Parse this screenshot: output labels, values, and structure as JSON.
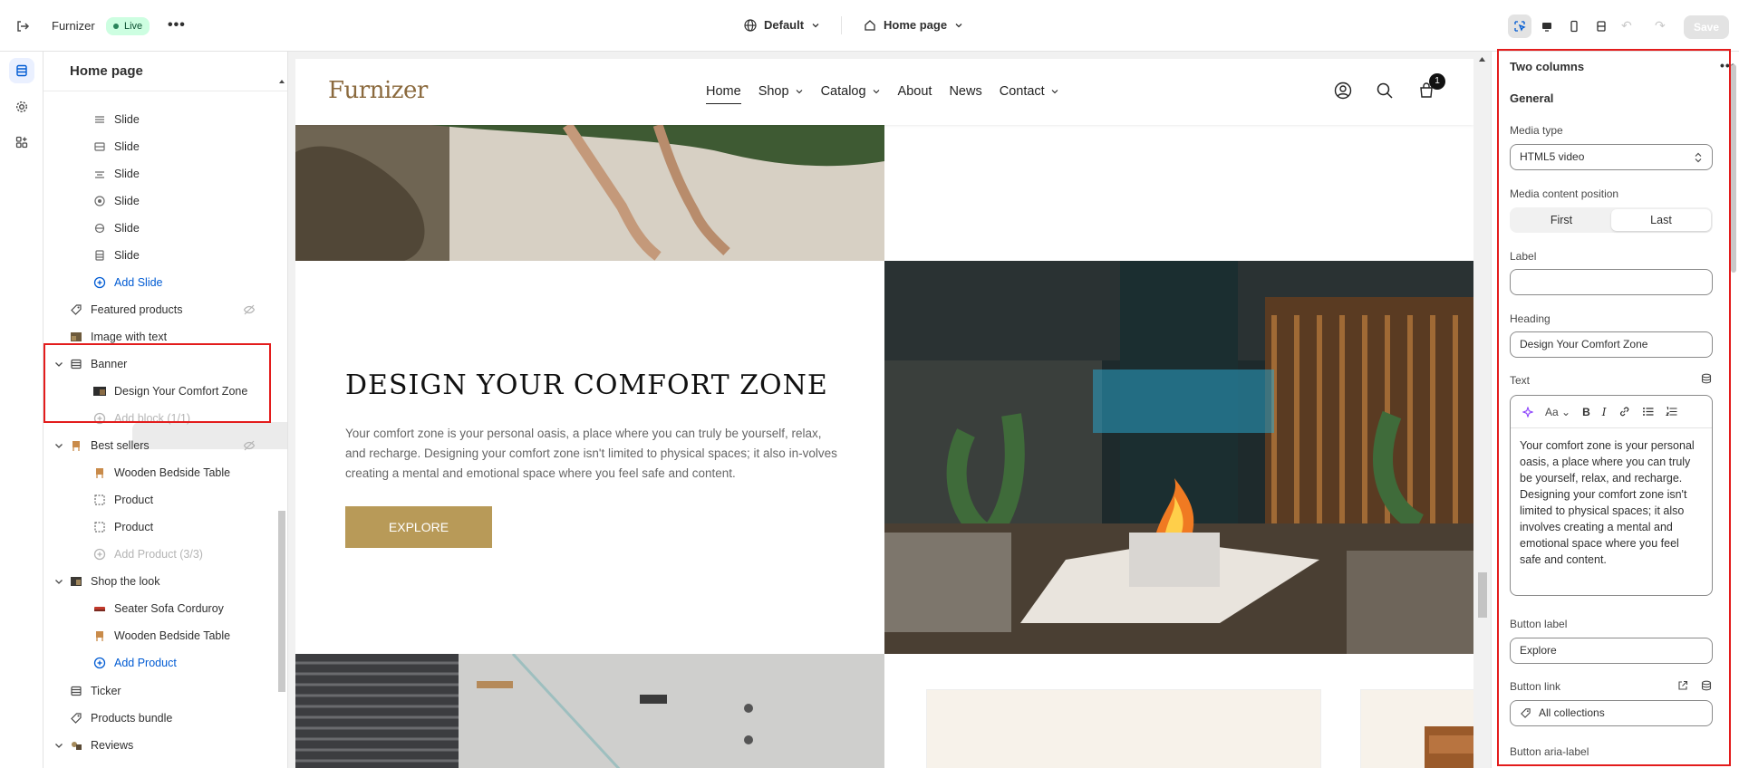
{
  "topbar": {
    "store_name": "Furnizer",
    "status_badge": "Live",
    "theme_name": "Default",
    "page_name": "Home page",
    "save_label": "Save"
  },
  "left_panel": {
    "title": "Home page",
    "items": [
      {
        "label": "Slide"
      },
      {
        "label": "Slide"
      },
      {
        "label": "Slide"
      },
      {
        "label": "Slide"
      },
      {
        "label": "Slide"
      },
      {
        "label": "Slide"
      },
      {
        "label": "Add Slide"
      },
      {
        "label": "Featured products"
      },
      {
        "label": "Image with text"
      },
      {
        "label": "Banner"
      },
      {
        "label": "Design Your Comfort Zone"
      },
      {
        "label": "Add block (1/1)"
      },
      {
        "label": "Best sellers"
      },
      {
        "label": "Wooden Bedside Table"
      },
      {
        "label": "Product"
      },
      {
        "label": "Product"
      },
      {
        "label": "Add Product (3/3)"
      },
      {
        "label": "Shop the look"
      },
      {
        "label": "Seater Sofa Corduroy"
      },
      {
        "label": "Wooden Bedside Table"
      },
      {
        "label": "Add Product"
      },
      {
        "label": "Ticker"
      },
      {
        "label": "Products bundle"
      },
      {
        "label": "Reviews"
      }
    ]
  },
  "preview": {
    "logo": "Furnizer",
    "nav": [
      "Home",
      "Shop",
      "Catalog",
      "About",
      "News",
      "Contact"
    ],
    "cart_count": "1",
    "banner": {
      "heading": "DESIGN YOUR COMFORT ZONE",
      "text": "Your comfort zone is your personal oasis, a place where you can truly be yourself, relax, and recharge. Designing your comfort zone isn't limited to physical spaces; it also in-volves creating a mental and emotional space where you feel safe and content.",
      "button": "EXPLORE"
    }
  },
  "settings": {
    "title": "Two columns",
    "section": "General",
    "media_type_label": "Media type",
    "media_type_value": "HTML5 video",
    "media_position_label": "Media content position",
    "media_position_options": [
      "First",
      "Last"
    ],
    "media_position_selected": "Last",
    "label_label": "Label",
    "label_value": "",
    "heading_label": "Heading",
    "heading_value": "Design Your Comfort Zone",
    "text_label": "Text",
    "text_value": "Your comfort zone is your personal oasis, a place where you can truly be yourself, relax, and recharge. Designing your comfort zone isn't limited to physical spaces; it also involves creating a mental and emotional space where you feel safe and content.",
    "button_label_label": "Button label",
    "button_label_value": "Explore",
    "button_link_label": "Button link",
    "button_link_value": "All collections",
    "button_aria_label": "Button aria-label"
  },
  "colors": {
    "accent_blue": "#005bd3",
    "highlight_red": "#e31c1c",
    "explore_button": "#b89a58"
  }
}
